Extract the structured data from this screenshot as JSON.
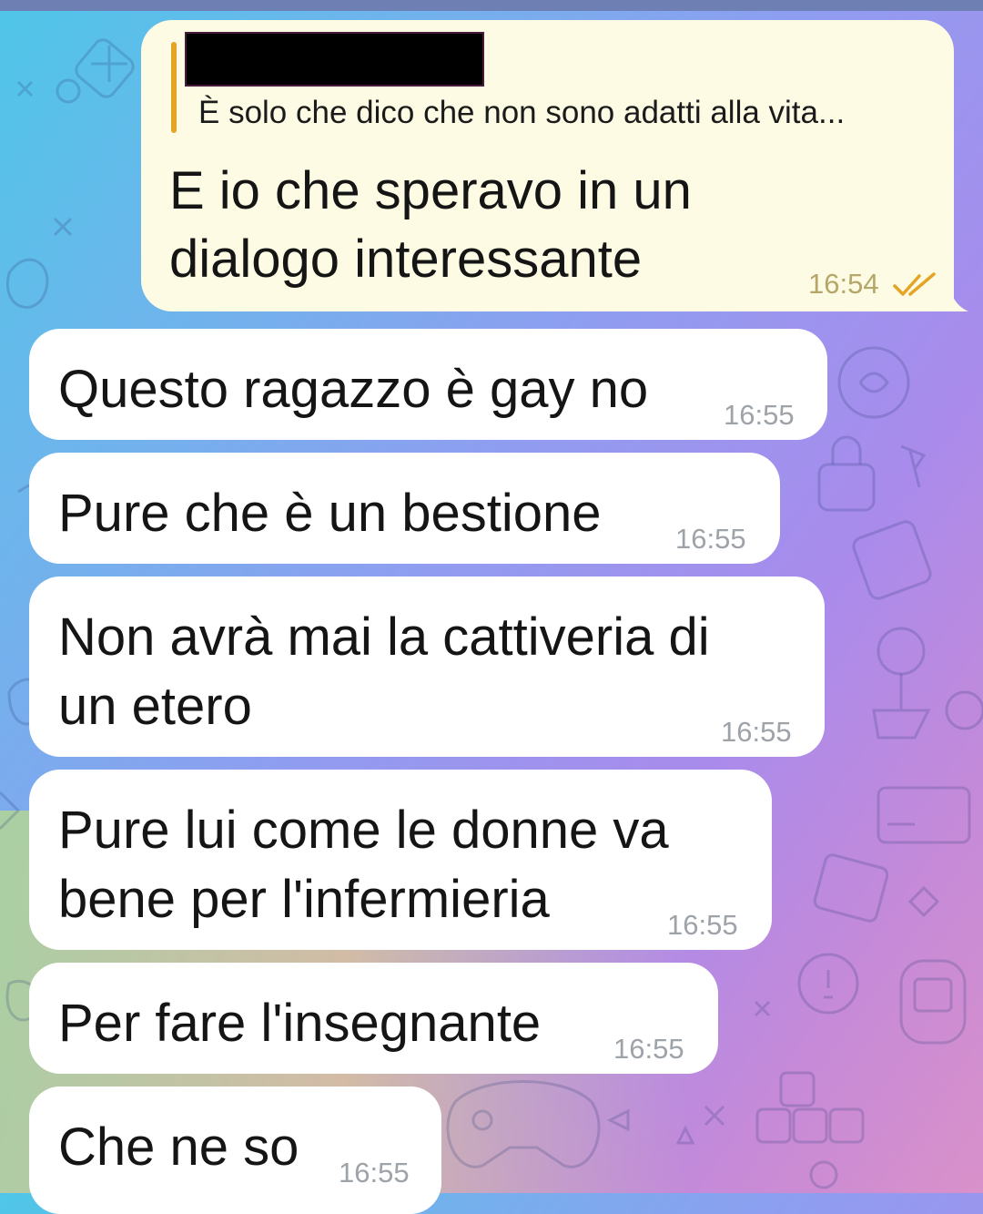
{
  "outgoing": {
    "reply_sender_redacted": true,
    "reply_preview": "È solo che dico che non sono adatti alla vita...",
    "text_line1": "E io che speravo in un",
    "text_line2": "dialogo interessante",
    "time": "16:54",
    "status": "read-double-check-icon",
    "bubble_color": "#fdfbe3",
    "accent_color": "#e4a425"
  },
  "incoming": [
    {
      "line1": "Questo ragazzo è gay no",
      "line2": "",
      "time": "16:55"
    },
    {
      "line1": "Pure che è un bestione",
      "line2": "",
      "time": "16:55"
    },
    {
      "line1": "Non avrà mai la cattiveria di",
      "line2": "un etero",
      "time": "16:55"
    },
    {
      "line1": "Pure lui come le donne va",
      "line2": "bene per l'infermieria",
      "time": "16:55"
    },
    {
      "line1": "Per fare l'insegnante",
      "line2": "",
      "time": "16:55"
    },
    {
      "line1": "Che ne so",
      "line2": "",
      "time": "16:55"
    }
  ],
  "colors": {
    "incoming_bubble": "#ffffff",
    "time_incoming": "#9ea3a9",
    "time_outgoing": "#b5a66a"
  }
}
